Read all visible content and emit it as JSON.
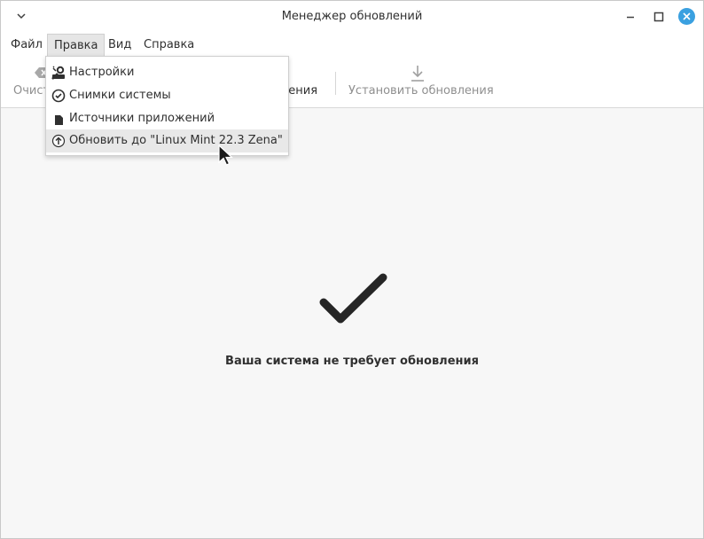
{
  "window": {
    "title": "Менеджер обновлений",
    "accent_color": "#3aa0e0"
  },
  "menubar": {
    "items": [
      {
        "label": "Файл"
      },
      {
        "label": "Правка",
        "active": true
      },
      {
        "label": "Вид"
      },
      {
        "label": "Справка"
      }
    ]
  },
  "toolbar": {
    "clear_label": "Очист",
    "refresh_label": "ления",
    "install_label": "Установить обновления"
  },
  "edit_menu": {
    "items": [
      {
        "label": "Настройки",
        "icon": "preferences-icon"
      },
      {
        "label": "Снимки системы",
        "icon": "clock-icon"
      },
      {
        "label": "Источники приложений",
        "icon": "package-icon"
      },
      {
        "label": "Обновить до \"Linux Mint 22.3 Zena\"",
        "icon": "upgrade-arrow-icon",
        "hovered": true
      }
    ]
  },
  "main": {
    "status_icon": "checkmark-icon",
    "status_text": "Ваша система не требует обновления"
  }
}
